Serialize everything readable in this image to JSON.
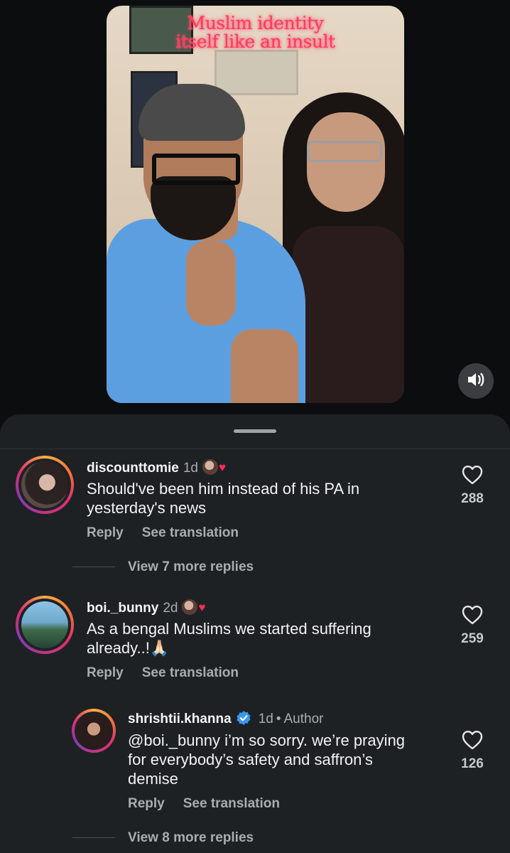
{
  "video": {
    "overlay_title_line1": "Muslim identity",
    "overlay_title_line2": "itself like an insult",
    "sound_icon": "speaker-volume-icon"
  },
  "comments": [
    {
      "username": "discounttomie",
      "time": "1d",
      "text_line1": "Should've been him instead of his PA in",
      "text_line2": "yesterday's news",
      "reply_label": "Reply",
      "translate_label": "See translation",
      "likes": "288",
      "view_replies": "View 7 more replies"
    },
    {
      "username": "boi._bunny",
      "time": "2d",
      "text_line1": "As a bengal Muslims we started suffering",
      "text_line2": "already..!🙏🏻",
      "reply_label": "Reply",
      "translate_label": "See translation",
      "likes": "259"
    }
  ],
  "reply": {
    "username": "shrishtii.khanna",
    "time": "1d",
    "separator": "•",
    "author_label": "Author",
    "text_line1": "@boi._bunny i’m so sorry. we’re praying",
    "text_line2": "for everybody’s safety and saffron’s",
    "text_line3": "demise",
    "reply_label": "Reply",
    "translate_label": "See translation",
    "likes": "126",
    "view_replies": "View 8 more replies"
  },
  "colors": {
    "background": "#0b0d0e",
    "sheet": "#1e2123",
    "verified": "#3897f0",
    "overlay_text": "#ff3b5c"
  }
}
